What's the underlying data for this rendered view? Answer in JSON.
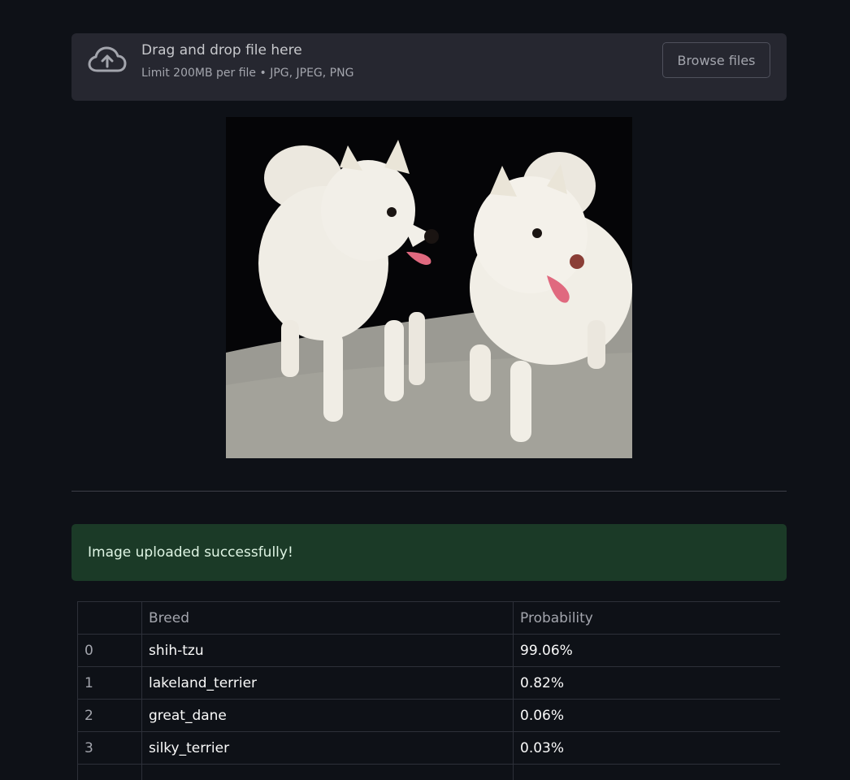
{
  "uploader": {
    "icon": "cloud-upload-icon",
    "title": "Drag and drop file here",
    "limit": "Limit 200MB per file • JPG, JPEG, PNG",
    "browse_label": "Browse files"
  },
  "image": {
    "subject": "two white fluffy dogs",
    "alt": "Uploaded image"
  },
  "alert": {
    "message": "Image uploaded successfully!",
    "color": "#1b3a27"
  },
  "table": {
    "headers": [
      "",
      "Breed",
      "Probability"
    ],
    "rows": [
      {
        "index": "0",
        "breed": "shih-tzu",
        "probability": "99.06%"
      },
      {
        "index": "1",
        "breed": "lakeland_terrier",
        "probability": "0.82%"
      },
      {
        "index": "2",
        "breed": "great_dane",
        "probability": "0.06%"
      },
      {
        "index": "3",
        "breed": "silky_terrier",
        "probability": "0.03%"
      }
    ]
  },
  "colors": {
    "background": "#0e1117",
    "panel": "#262730"
  }
}
